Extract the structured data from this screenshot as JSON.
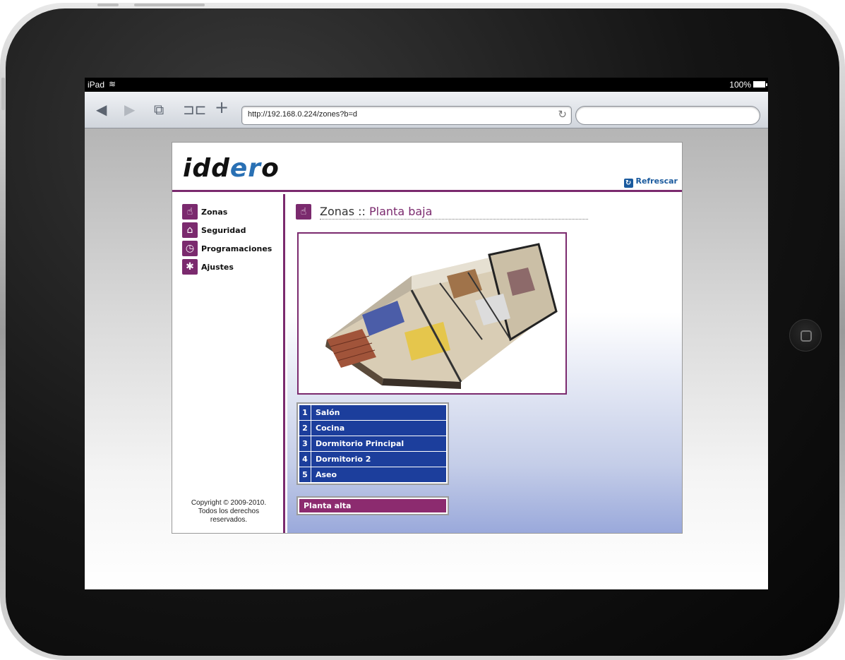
{
  "device": {
    "status_left": "iPad",
    "battery": "100%"
  },
  "browser": {
    "url": "http://192.168.0.224/zones?b=d",
    "search_placeholder": ""
  },
  "app": {
    "logo": {
      "part1": "idd",
      "part2": "er",
      "part3": "o"
    },
    "refresh_label": "Refrescar",
    "nav": [
      {
        "label": "Zonas",
        "icon": "hand-pointer-icon"
      },
      {
        "label": "Seguridad",
        "icon": "house-shield-icon"
      },
      {
        "label": "Programaciones",
        "icon": "clock-icon"
      },
      {
        "label": "Ajustes",
        "icon": "gear-icon"
      }
    ],
    "copyright": {
      "line1": "Copyright © 2009-2010.",
      "line2": "Todos los derechos",
      "line3": "reservados."
    },
    "page_title": "Zonas ::",
    "page_subtitle": "Planta baja",
    "zones": [
      {
        "num": "1",
        "name": "Salón"
      },
      {
        "num": "2",
        "name": "Cocina"
      },
      {
        "num": "3",
        "name": "Dormitorio Principal"
      },
      {
        "num": "4",
        "name": "Dormitorio 2"
      },
      {
        "num": "5",
        "name": "Aseo"
      }
    ],
    "other_floor": "Planta alta",
    "colors": {
      "accent": "#7b2a6e",
      "zone_blue": "#1c3e9c",
      "link_blue": "#1a5a9e"
    }
  }
}
